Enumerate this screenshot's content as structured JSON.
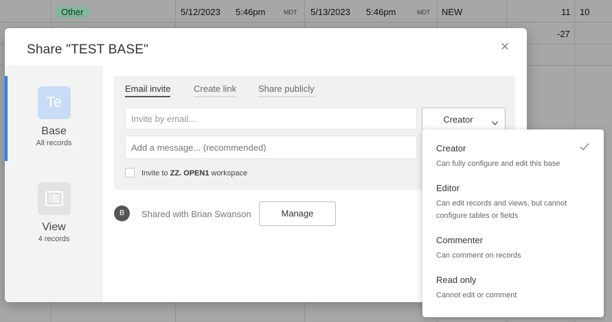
{
  "background": {
    "row1": {
      "tag": "Other",
      "start_date": "5/12/2023",
      "start_time": "5:46pm",
      "start_tz": "MDT",
      "end_date": "5/13/2023",
      "end_time": "5:46pm",
      "end_tz": "MDT",
      "status": "NEW",
      "num_a": "11",
      "num_b": "10"
    },
    "row2": {
      "num_a": "-27"
    }
  },
  "modal": {
    "title": "Share \"TEST BASE\"",
    "close_symbol": "×",
    "scopes": {
      "base": {
        "icon_text": "Te",
        "name": "Base",
        "sub": "All records"
      },
      "view": {
        "name": "View",
        "sub": "4 records",
        "icon": "grid-view-icon"
      }
    },
    "tabs": {
      "email": "Email invite",
      "link": "Create link",
      "public": "Share publicly"
    },
    "email_placeholder": "Invite by email...",
    "role_selected": "Creator",
    "message_placeholder": "Add a message... (recommended)",
    "workspace": {
      "prefix": "Invite to",
      "name": "ZZ. OPEN1",
      "suffix": "workspace"
    },
    "shared": {
      "avatar": "B",
      "text": "Shared with Brian Swanson",
      "manage": "Manage"
    }
  },
  "role_dropdown": {
    "options": [
      {
        "title": "Creator",
        "desc": "Can fully configure and edit this base",
        "selected": true
      },
      {
        "title": "Editor",
        "desc": "Can edit records and views, but cannot configure tables or fields"
      },
      {
        "title": "Commenter",
        "desc": "Can comment on records"
      },
      {
        "title": "Read only",
        "desc": "Cannot edit or comment"
      }
    ]
  },
  "colors": {
    "accent_blue": "#2d7ff9",
    "tag_green": "#7fb89a"
  }
}
